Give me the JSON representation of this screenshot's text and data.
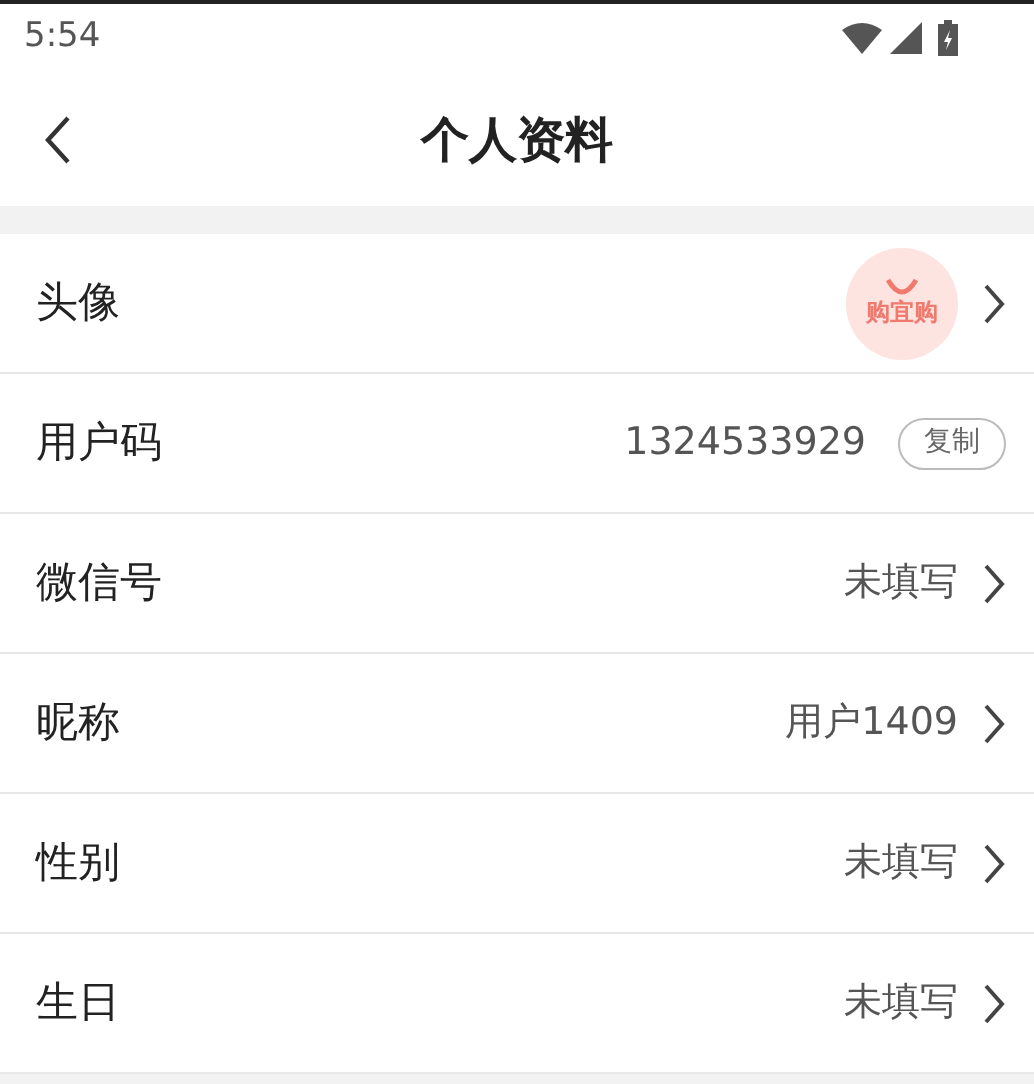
{
  "status_bar": {
    "time": "5:54"
  },
  "header": {
    "title": "个人资料"
  },
  "rows": [
    {
      "kind": "avatar",
      "label": "头像",
      "logo_text": "购宜购"
    },
    {
      "kind": "copy",
      "label": "用户码",
      "value": "1324533929",
      "button": "复制"
    },
    {
      "kind": "value",
      "label": "微信号",
      "value": "未填写"
    },
    {
      "kind": "value",
      "label": "昵称",
      "value": "用户1409"
    },
    {
      "kind": "value",
      "label": "性别",
      "value": "未填写"
    },
    {
      "kind": "value",
      "label": "生日",
      "value": "未填写"
    }
  ]
}
